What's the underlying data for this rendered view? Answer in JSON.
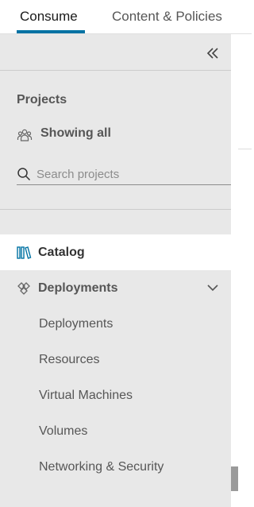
{
  "tabs": [
    {
      "label": "Consume",
      "active": true
    },
    {
      "label": "Content & Policies",
      "active": false
    }
  ],
  "accent_color": "#0072a3",
  "sidebar": {
    "collapse_icon": "double-chevron-left-icon",
    "projects": {
      "title": "Projects",
      "filter_label": "Showing all",
      "filter_icon": "people-icon"
    },
    "search": {
      "placeholder": "Search projects",
      "value": "",
      "icon": "search-icon"
    },
    "nav": [
      {
        "label": "Catalog",
        "icon": "catalog-icon",
        "selected": true
      },
      {
        "label": "Deployments",
        "icon": "deployments-icon",
        "expanded": true,
        "children": [
          {
            "label": "Deployments"
          },
          {
            "label": "Resources"
          },
          {
            "label": "Virtual Machines"
          },
          {
            "label": "Volumes"
          },
          {
            "label": "Networking & Security"
          }
        ]
      }
    ]
  }
}
